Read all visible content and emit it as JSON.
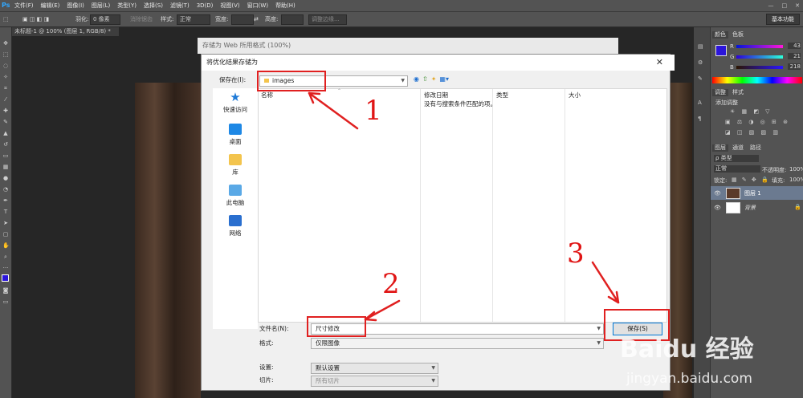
{
  "app": {
    "menu": [
      "文件(F)",
      "编辑(E)",
      "图像(I)",
      "图层(L)",
      "类型(Y)",
      "选择(S)",
      "滤镜(T)",
      "3D(D)",
      "视图(V)",
      "窗口(W)",
      "帮助(H)"
    ],
    "window_controls": [
      "—",
      "□",
      "✕"
    ]
  },
  "options_bar": {
    "feather_label": "羽化:",
    "feather_value": "0 像素",
    "antialias_label": "消除锯齿",
    "style_label": "样式:",
    "style_value": "正常",
    "width_label": "宽度:",
    "height_label": "高度:",
    "refine_label": "调整边缘...",
    "workspace": "基本功能"
  },
  "document": {
    "tab": "未标题-1 @ 100% (图层 1, RGB/8) *"
  },
  "panels": {
    "color_tabs": [
      "颜色",
      "色板"
    ],
    "rgb": [
      {
        "ch": "R",
        "val": "43"
      },
      {
        "ch": "G",
        "val": "21"
      },
      {
        "ch": "B",
        "val": "218"
      }
    ],
    "adjust_tabs": [
      "调整",
      "样式"
    ],
    "adjust_title": "添加调整",
    "layer_tabs": [
      "图层",
      "通道",
      "路径"
    ],
    "kind_label": "ρ 类型",
    "blend": "正常",
    "opacity_label": "不透明度:",
    "opacity_value": "100%",
    "lock_label": "锁定:",
    "fill_label": "填充:",
    "fill_value": "100%",
    "layers": [
      "图层 1",
      "背景"
    ]
  },
  "web_dialog_title": "存储为 Web 所用格式 (100%)",
  "save_dialog": {
    "title": "将优化结果存储为",
    "close": "✕",
    "save_in_label": "保存在(I):",
    "save_in_value": "images",
    "places": [
      "快速访问",
      "桌面",
      "库",
      "此电脑",
      "网络"
    ],
    "columns": [
      "名称",
      "修改日期",
      "类型",
      "大小"
    ],
    "empty_message": "没有与搜索条件匹配的项。",
    "filename_label": "文件名(N):",
    "filename_value": "尺寸修改",
    "format_label": "格式:",
    "format_value": "仅限图像",
    "save_button": "保存(S)",
    "settings_label": "设置:",
    "settings_value": "默认设置",
    "slices_label": "切片:",
    "slices_value": "所有切片"
  },
  "annotations": [
    "1",
    "2",
    "3"
  ],
  "watermark": {
    "brand": "Baidu 经验",
    "url": "jingyan.baidu.com"
  },
  "colors": {
    "accent": "#0078d7",
    "annotation": "#e02020",
    "fg_swatch": "#2b15da"
  }
}
